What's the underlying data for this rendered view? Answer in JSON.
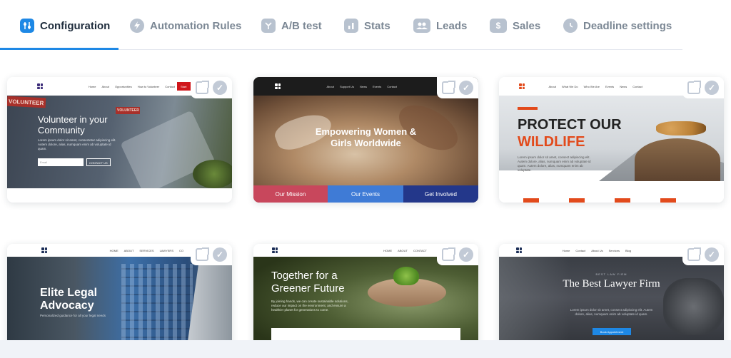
{
  "tabs": [
    {
      "label": "Configuration",
      "icon": "sliders-icon",
      "active": true
    },
    {
      "label": "Automation Rules",
      "icon": "bolt-icon"
    },
    {
      "label": "A/B test",
      "icon": "split-icon"
    },
    {
      "label": "Stats",
      "icon": "bar-chart-icon"
    },
    {
      "label": "Leads",
      "icon": "users-icon"
    },
    {
      "label": "Sales",
      "icon": "dollar-icon"
    },
    {
      "label": "Deadline settings",
      "icon": "clock-icon"
    }
  ],
  "templates": [
    {
      "name": "volunteer",
      "nav": [
        "Home",
        "About",
        "Opportunities",
        "How to Volunteer",
        "Contact"
      ],
      "nav_button": "Start",
      "badge1": "VOLUNTEER",
      "badge2": "VOLUNTEER",
      "title": "Volunteer in your Community",
      "text": "Lorem ipsum dolor sit amet, consectetur adipiscing elit. Autem dolore, alias, numquam enim ab voluptate id quam.",
      "email_placeholder": "Email",
      "button": "CONTACT US"
    },
    {
      "name": "women",
      "nav": [
        "About",
        "Support Us",
        "News",
        "Events",
        "Contact"
      ],
      "title": "Empowering Women & Girls Worldwide",
      "buttons": [
        "Our Mission",
        "Our Events",
        "Get Involved"
      ]
    },
    {
      "name": "wildlife",
      "nav": [
        "About",
        "What We Do",
        "Who We Are",
        "Events",
        "News",
        "Contact"
      ],
      "title1": "PROTECT OUR",
      "title2": "WILDLIFE",
      "text": "Lorem ipsum dolor sit amet, consect adipiscing elit. Autem dolore, alias, numquam enim ab voluptate id quam. Autem dolore, alias, numquam enim ab voluptate."
    },
    {
      "name": "legal",
      "nav": [
        "HOME",
        "ABOUT",
        "SERVICES",
        "LAWYERS",
        "CO"
      ],
      "title": "Elite Legal Advocacy",
      "text": "Personalized guidance for all your legal needs"
    },
    {
      "name": "green",
      "nav": [
        "HOME",
        "ABOUT",
        "CONTACT"
      ],
      "title": "Together for a Greener Future",
      "text": "By joining hands, we can create sustainable solutions, reduce our impact on the environment, and ensure a healthier planet for generations to come."
    },
    {
      "name": "lawyer",
      "nav": [
        "Home",
        "Contact",
        "About Us",
        "Services",
        "Blog"
      ],
      "kicker": "BEST LAW FIRM",
      "title": "The Best Lawyer Firm",
      "text": "Lorem ipsum dolor sit amet, consect adipiscing elit. Autem dolore, alias, numquam enim ab voluptate id quam.",
      "button": "Book Appointment"
    }
  ],
  "colors": {
    "accent": "#1e88e5",
    "inactive_icon": "#b8c2cf"
  }
}
